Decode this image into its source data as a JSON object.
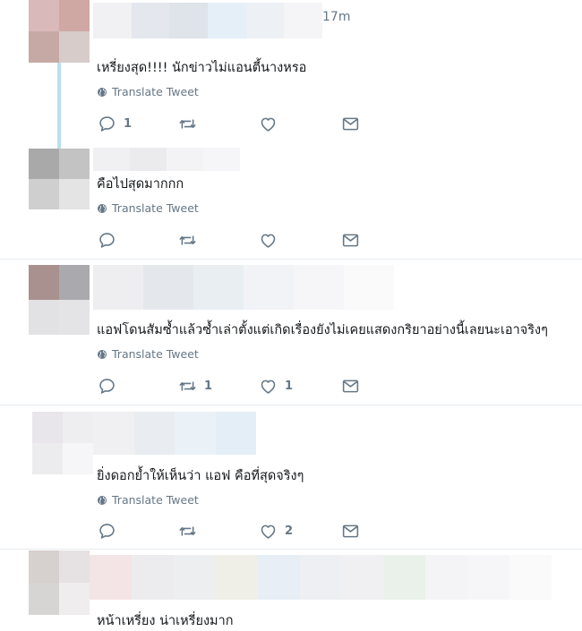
{
  "icons": {
    "reply": "reply-icon",
    "retweet": "retweet-icon",
    "like": "heart-icon",
    "dm": "mail-icon",
    "translate": "globe-icon"
  },
  "colors": {
    "thread_line": "#b8e0ee",
    "icon_gray": "#657786",
    "divider": "#e6ecf0"
  },
  "tweets": [
    {
      "time": "17m",
      "text": "เหรี่ยงสุด!!!! นักข่าวไม่แอนตี้นางหรอ",
      "translate": "Translate Tweet",
      "reply_count": "1",
      "retweet_count": "",
      "like_count": ""
    },
    {
      "time": "",
      "text": "คือไปสุดมากกก",
      "translate": "Translate Tweet",
      "reply_count": "",
      "retweet_count": "",
      "like_count": ""
    },
    {
      "time": "",
      "text": "แอฟโดนสัมซ้ำแล้วซ้ำเล่าตั้งแต่เกิดเรื่องยังไม่เคยแสดงกริยาอย่างนี้เลยนะเอาจริงๆ",
      "translate": "Translate Tweet",
      "reply_count": "",
      "retweet_count": "1",
      "like_count": "1"
    },
    {
      "time": "",
      "text": "ยิ่งดอกย้ำให้เห็นว่า แอฟ คือที่สุดจริงๆ",
      "translate": "Translate Tweet",
      "reply_count": "",
      "retweet_count": "",
      "like_count": "2"
    },
    {
      "time": "",
      "text": "หน้าเหรี่ยง น่าเหรี่ยงมาก",
      "translate": "",
      "reply_count": "",
      "retweet_count": "",
      "like_count": ""
    }
  ]
}
